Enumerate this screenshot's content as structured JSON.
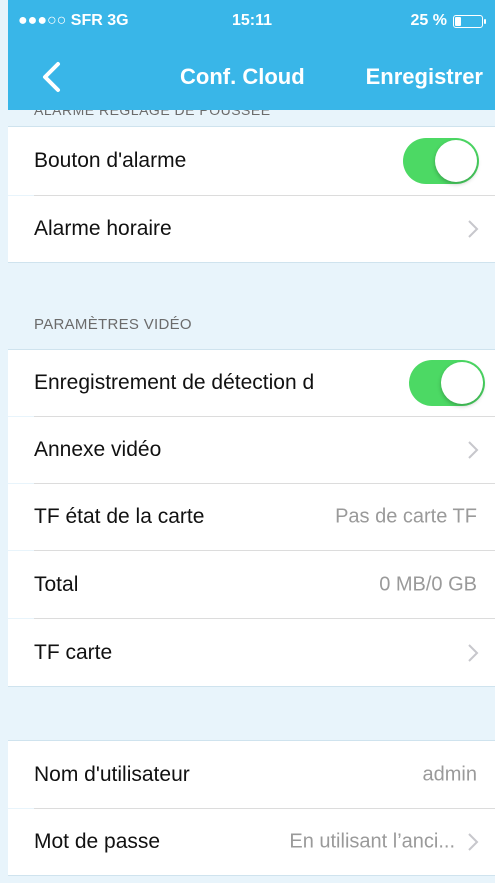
{
  "status_bar": {
    "carrier": "●●●○○ SFR  3G",
    "time": "15:11",
    "battery": "25 %"
  },
  "nav": {
    "title": "Conf. Cloud",
    "save_label": "Enregistrer"
  },
  "sections": {
    "alarm": {
      "header": "ALARME RÉGLAGE DE POUSSÉE",
      "rows": [
        {
          "label": "Bouton d'alarme",
          "toggle": "on"
        },
        {
          "label": "Alarme horaire"
        }
      ]
    },
    "video": {
      "header": "PARAMÈTRES VIDÉO",
      "rows": [
        {
          "label": "Enregistrement de détection d",
          "toggle": "on"
        },
        {
          "label": "Annexe vidéo"
        },
        {
          "label": "TF état de la carte",
          "value": "Pas de carte TF"
        },
        {
          "label": "Total",
          "value": "0 MB/0 GB"
        },
        {
          "label": "TF carte"
        }
      ]
    },
    "account": {
      "rows": [
        {
          "label": "Nom d'utilisateur",
          "value": "admin"
        },
        {
          "label": "Mot de passe",
          "value": "En utilisant l’anci..."
        }
      ]
    }
  },
  "colors": {
    "accent": "#39b6e8",
    "toggle_on": "#4cd964",
    "background": "#e8f4fb"
  }
}
